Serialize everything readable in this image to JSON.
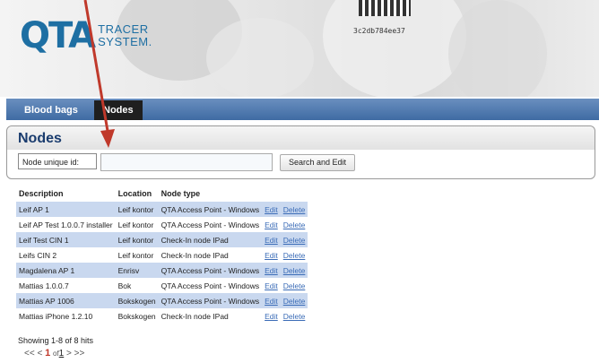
{
  "logo": {
    "mark": "QTA",
    "line1": "TRACER",
    "line2": "SYSTEM."
  },
  "header": {
    "code_hash": "3c2db784ee37"
  },
  "nav": {
    "tabs": [
      {
        "label": "Blood bags"
      },
      {
        "label": "Nodes"
      }
    ]
  },
  "page": {
    "title": "Nodes"
  },
  "search": {
    "label": "Node unique id:",
    "value": "",
    "button": "Search and Edit"
  },
  "table": {
    "headers": [
      "Description",
      "Location",
      "Node type"
    ],
    "rows": [
      {
        "description": "Leif AP 1",
        "location": "Leif kontor",
        "type": "QTA Access Point - Windows",
        "edit": "Edit",
        "delete": "Delete"
      },
      {
        "description": "Leif AP Test 1.0.0.7 installer",
        "location": "Leif kontor",
        "type": "QTA Access Point - Windows",
        "edit": "Edit",
        "delete": "Delete"
      },
      {
        "description": "Leif Test CIN 1",
        "location": "Leif kontor",
        "type": "Check-In node IPad",
        "edit": "Edit",
        "delete": "Delete"
      },
      {
        "description": "Leifs CIN 2",
        "location": "Leif kontor",
        "type": "Check-In node IPad",
        "edit": "Edit",
        "delete": "Delete"
      },
      {
        "description": "Magdalena AP 1",
        "location": "Enrisv",
        "type": "QTA Access Point - Windows",
        "edit": "Edit",
        "delete": "Delete"
      },
      {
        "description": "Mattias 1.0.0.7",
        "location": "Bok",
        "type": "QTA Access Point - Windows",
        "edit": "Edit",
        "delete": "Delete"
      },
      {
        "description": "Mattias AP 1006",
        "location": "Bokskogen",
        "type": "QTA Access Point - Windows",
        "edit": "Edit",
        "delete": "Delete"
      },
      {
        "description": "Mattias iPhone 1.2.10",
        "location": "Bokskogen",
        "type": "Check-In node IPad",
        "edit": "Edit",
        "delete": "Delete"
      }
    ]
  },
  "status": {
    "hits": "Showing 1-8 of 8 hits"
  },
  "pager": {
    "first": "<<",
    "prev": "<",
    "current": "1",
    "of": "of",
    "total": "1",
    "next": ">",
    "last": ">>"
  },
  "colors": {
    "accent": "#1e6fa3",
    "nav": "#3f6ba3",
    "row_alt": "#c9d8ef",
    "arrow": "#c0392b"
  }
}
